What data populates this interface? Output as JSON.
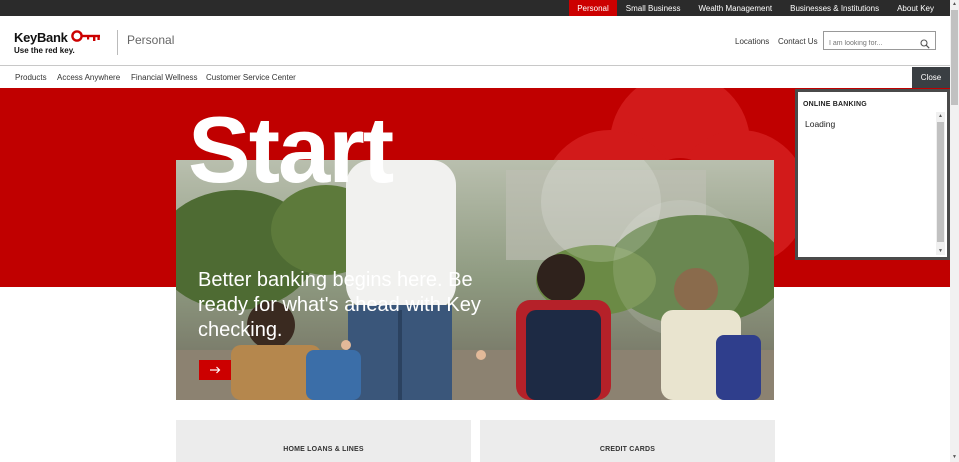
{
  "topbar": {
    "items": [
      "Personal",
      "Small Business",
      "Wealth Management",
      "Businesses & Institutions",
      "About Key"
    ],
    "active": "Personal"
  },
  "header": {
    "brand": "KeyBank",
    "tagline": "Use the red key.",
    "segment": "Personal",
    "locations": "Locations",
    "contact": "Contact Us",
    "search_placeholder": "I am looking for...",
    "icons": {
      "logo": "key-icon",
      "search": "search-icon"
    }
  },
  "nav": {
    "items": [
      "Products",
      "Access Anywhere",
      "Financial Wellness",
      "Customer Service Center"
    ],
    "close": "Close"
  },
  "hero": {
    "title": "Start",
    "text": "Better banking begins here. Be ready for what's ahead with Key checking.",
    "cta_icon": "arrow-right-icon"
  },
  "cards": [
    "HOME LOANS & LINES",
    "CREDIT CARDS"
  ],
  "online_banking": {
    "heading": "ONLINE BANKING",
    "status": "Loading"
  },
  "colors": {
    "brand_red": "#cc0000",
    "hero_red": "#c00000",
    "topbar": "#2b2b2b",
    "close_btn": "#3a3f43"
  }
}
